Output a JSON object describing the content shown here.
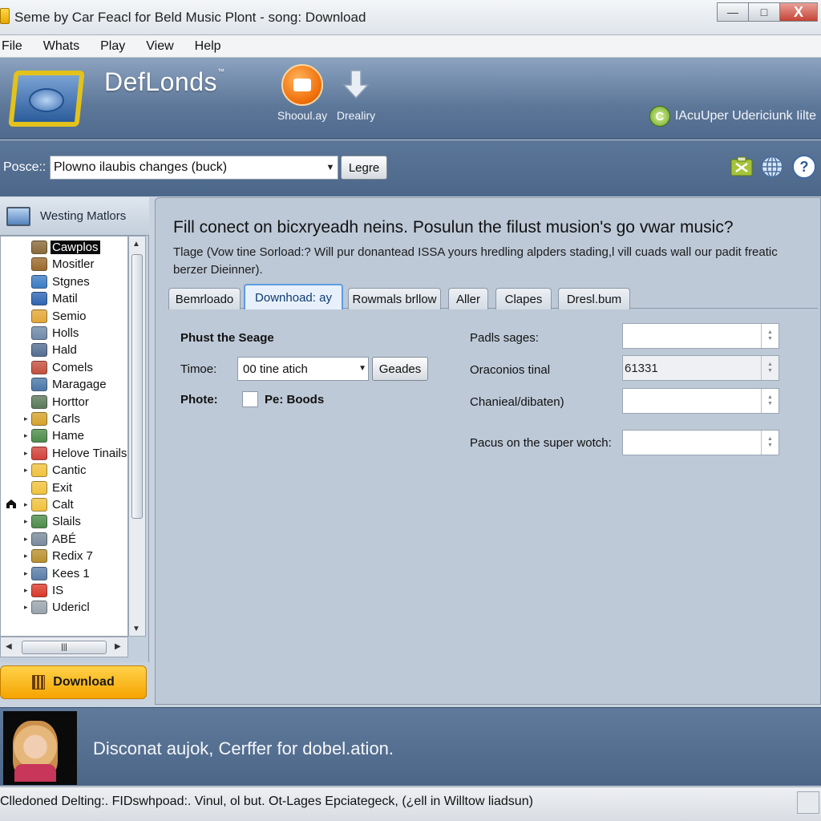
{
  "window": {
    "title": "Seme by Car Feacl for Beld Music Plont - song: Download",
    "min_label": "—",
    "max_label": "□",
    "close_label": "X"
  },
  "menu": [
    "File",
    "Whats",
    "Play",
    "View",
    "Help"
  ],
  "banner": {
    "brand": "DefLonds",
    "trademark": "™",
    "tool1_label": "Shooul.ay",
    "tool2_label": "Drealiry",
    "upgrade_text": "IAcuUper Udericiunk Iilte",
    "badge_letter": "C"
  },
  "search": {
    "label": "Posce::",
    "value": "Plowno ilaubis changes (buck)",
    "button": "Legre"
  },
  "sidebar": {
    "header": "Westing Matlors",
    "items": [
      {
        "label": "Cawplos",
        "icon": "music-folder-icon",
        "color": "#8a6a3a",
        "expander": false,
        "selected": true
      },
      {
        "label": "Mositler",
        "icon": "grid-icon",
        "color": "#9b6a2c",
        "expander": false
      },
      {
        "label": "Stgnes",
        "icon": "globe-icon",
        "color": "#3b7cc4",
        "expander": false
      },
      {
        "label": "Matil",
        "icon": "info-icon",
        "color": "#2f66b3",
        "expander": false
      },
      {
        "label": "Semio",
        "icon": "folder-open-icon",
        "color": "#e2a737",
        "expander": false
      },
      {
        "label": "Holls",
        "icon": "stack-icon",
        "color": "#6f8aa8",
        "expander": false
      },
      {
        "label": "Hald",
        "icon": "info-icon",
        "color": "#546e92",
        "expander": false
      },
      {
        "label": "Comels",
        "icon": "people-icon",
        "color": "#c4503f",
        "expander": false
      },
      {
        "label": "Maragage",
        "icon": "person-icon",
        "color": "#4a78a8",
        "expander": false
      },
      {
        "label": "Horttor",
        "icon": "tree-icon",
        "color": "#5b7a5a",
        "expander": false
      },
      {
        "label": "Carls",
        "icon": "chart-icon",
        "color": "#d4a32b",
        "expander": true
      },
      {
        "label": "Hame",
        "icon": "image-icon",
        "color": "#4d8c4a",
        "expander": true
      },
      {
        "label": "Helove Tinails",
        "icon": "document-icon",
        "color": "#d1423a",
        "expander": true
      },
      {
        "label": "Cantic",
        "icon": "folder-icon",
        "color": "#f0c23e",
        "expander": true
      },
      {
        "label": "Exit",
        "icon": "folder-icon",
        "color": "#f0c23e",
        "expander": false
      },
      {
        "label": "Calt",
        "icon": "folder-icon",
        "color": "#f0c23e",
        "expander": true
      },
      {
        "label": "Slails",
        "icon": "image-icon",
        "color": "#4d8c4a",
        "expander": true
      },
      {
        "label": "ABÉ",
        "icon": "grid-icon",
        "color": "#7a8a9c",
        "expander": true
      },
      {
        "label": "Redix 7",
        "icon": "film-icon",
        "color": "#b9902e",
        "expander": true
      },
      {
        "label": "Kees 1",
        "icon": "screen-icon",
        "color": "#5a7ea8",
        "expander": true
      },
      {
        "label": "IS",
        "icon": "record-icon",
        "color": "#d93a2b",
        "expander": true
      },
      {
        "label": "Udericl",
        "icon": "disc-icon",
        "color": "#9aa3ad",
        "expander": true
      }
    ],
    "download_button": "Download"
  },
  "main": {
    "heading": "Fill conect on bicxryeadh neins. Posulun the filust musion's go vwar music?",
    "description": "Tlage (Vow tine Sorload:? Will pur donantead ISSA yours hredling alpders stading,l vill cuads wall our padit freatic berzer Dieinner).",
    "tabs": [
      "Bemrloado",
      "Downhoad: ay",
      "Rowmals brllow",
      "Aller",
      "Clapes",
      "Dresl.bum"
    ],
    "active_tab": 1,
    "left_form": {
      "section_title": "Phust the Seage",
      "time_label": "Timoe:",
      "time_value": "00 tine atich",
      "time_button": "Geades",
      "photo_label": "Phote:",
      "checkbox_label": "Pe: Boods"
    },
    "right_form": [
      {
        "label": "Padls sages:",
        "value": ""
      },
      {
        "label": "Oraconios tinal",
        "value": "61331"
      },
      {
        "label": "Chanieal/dibaten)",
        "value": ""
      },
      {
        "label": "Pacus on the super wotch:",
        "value": ""
      }
    ]
  },
  "promo": {
    "message": "Disconat aujok, Cerffer for dobel.ation."
  },
  "status": {
    "text": "Clledoned Delting:. FIDswhpoad:. Vinul, ol but. Ot-Lages Epciategeck, (¿ell in Willtow liadsun)"
  }
}
